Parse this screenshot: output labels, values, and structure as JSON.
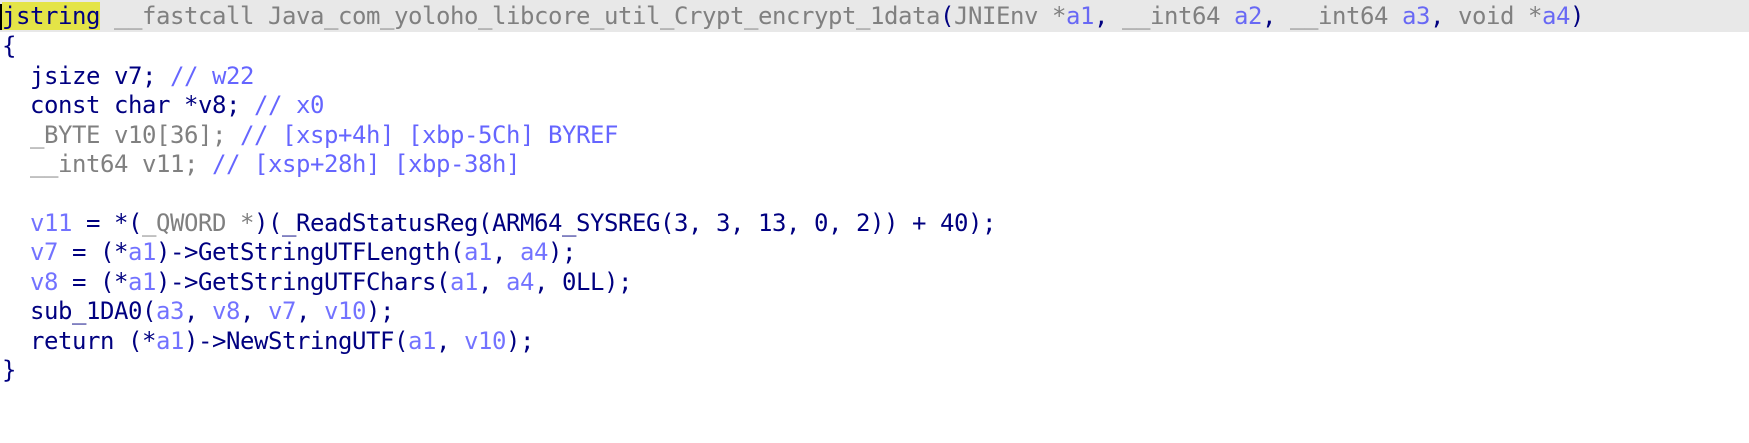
{
  "editor": {
    "lines": [
      {
        "id": "signature",
        "tokens": [
          {
            "text": "jstring",
            "kind": "hl"
          },
          {
            "text": " __fastcall Java_com_yoloho_libcore_util_Crypt_encrypt_1data",
            "kind": "gray"
          },
          {
            "text": "(",
            "kind": "punc"
          },
          {
            "text": "JNIEnv *",
            "kind": "gray"
          },
          {
            "text": "a1",
            "kind": "var"
          },
          {
            "text": ", ",
            "kind": "punc"
          },
          {
            "text": "__int64 ",
            "kind": "gray"
          },
          {
            "text": "a2",
            "kind": "var"
          },
          {
            "text": ", ",
            "kind": "punc"
          },
          {
            "text": "__int64 ",
            "kind": "gray"
          },
          {
            "text": "a3",
            "kind": "var"
          },
          {
            "text": ", ",
            "kind": "punc"
          },
          {
            "text": "void *",
            "kind": "gray"
          },
          {
            "text": "a4",
            "kind": "var"
          },
          {
            "text": ")",
            "kind": "punc"
          }
        ]
      },
      {
        "id": "open-brace",
        "tokens": [
          {
            "text": "{",
            "kind": "punc"
          }
        ]
      },
      {
        "id": "decl-v7",
        "tokens": [
          {
            "text": "  jsize ",
            "kind": "kw"
          },
          {
            "text": "v7",
            "kind": "plain"
          },
          {
            "text": "; ",
            "kind": "punc"
          },
          {
            "text": "// w22",
            "kind": "cm"
          }
        ]
      },
      {
        "id": "decl-v8",
        "tokens": [
          {
            "text": "  const char *",
            "kind": "kw"
          },
          {
            "text": "v8",
            "kind": "plain"
          },
          {
            "text": "; ",
            "kind": "punc"
          },
          {
            "text": "// x0",
            "kind": "cm"
          }
        ]
      },
      {
        "id": "decl-v10",
        "tokens": [
          {
            "text": "  _BYTE v10[36]; ",
            "kind": "gray"
          },
          {
            "text": "// [xsp+4h] [xbp-5Ch] BYREF",
            "kind": "cm"
          }
        ]
      },
      {
        "id": "decl-v11",
        "tokens": [
          {
            "text": "  __int64 v11; ",
            "kind": "gray"
          },
          {
            "text": "// [xsp+28h] [xbp-38h]",
            "kind": "cm"
          }
        ]
      },
      {
        "id": "blank",
        "tokens": [
          {
            "text": "",
            "kind": "plain"
          }
        ]
      },
      {
        "id": "stmt-v11",
        "tokens": [
          {
            "text": "  ",
            "kind": "plain"
          },
          {
            "text": "v11",
            "kind": "var"
          },
          {
            "text": " = *(",
            "kind": "punc"
          },
          {
            "text": "_QWORD *",
            "kind": "gray"
          },
          {
            "text": ")(",
            "kind": "punc"
          },
          {
            "text": "_ReadStatusReg",
            "kind": "fn"
          },
          {
            "text": "(ARM64_SYSREG(3, 3, 13, 0, 2)) + 40);",
            "kind": "punc"
          }
        ]
      },
      {
        "id": "stmt-v7",
        "tokens": [
          {
            "text": "  ",
            "kind": "plain"
          },
          {
            "text": "v7",
            "kind": "var"
          },
          {
            "text": " = (*",
            "kind": "punc"
          },
          {
            "text": "a1",
            "kind": "var"
          },
          {
            "text": ")->GetStringUTFLength(",
            "kind": "punc"
          },
          {
            "text": "a1",
            "kind": "var"
          },
          {
            "text": ", ",
            "kind": "punc"
          },
          {
            "text": "a4",
            "kind": "var"
          },
          {
            "text": ");",
            "kind": "punc"
          }
        ]
      },
      {
        "id": "stmt-v8",
        "tokens": [
          {
            "text": "  ",
            "kind": "plain"
          },
          {
            "text": "v8",
            "kind": "var"
          },
          {
            "text": " = (*",
            "kind": "punc"
          },
          {
            "text": "a1",
            "kind": "var"
          },
          {
            "text": ")->GetStringUTFChars(",
            "kind": "punc"
          },
          {
            "text": "a1",
            "kind": "var"
          },
          {
            "text": ", ",
            "kind": "punc"
          },
          {
            "text": "a4",
            "kind": "var"
          },
          {
            "text": ", 0LL);",
            "kind": "punc"
          }
        ]
      },
      {
        "id": "stmt-sub",
        "tokens": [
          {
            "text": "  sub_1DA0(",
            "kind": "fn"
          },
          {
            "text": "a3",
            "kind": "var"
          },
          {
            "text": ", ",
            "kind": "punc"
          },
          {
            "text": "v8",
            "kind": "var"
          },
          {
            "text": ", ",
            "kind": "punc"
          },
          {
            "text": "v7",
            "kind": "var"
          },
          {
            "text": ", ",
            "kind": "punc"
          },
          {
            "text": "v10",
            "kind": "var"
          },
          {
            "text": ");",
            "kind": "punc"
          }
        ]
      },
      {
        "id": "stmt-return",
        "tokens": [
          {
            "text": "  return (*",
            "kind": "kw"
          },
          {
            "text": "a1",
            "kind": "var"
          },
          {
            "text": ")->NewStringUTF(",
            "kind": "punc"
          },
          {
            "text": "a1",
            "kind": "var"
          },
          {
            "text": ", ",
            "kind": "punc"
          },
          {
            "text": "v10",
            "kind": "var"
          },
          {
            "text": ");",
            "kind": "punc"
          }
        ]
      },
      {
        "id": "close-brace",
        "tokens": [
          {
            "text": "}",
            "kind": "punc"
          }
        ]
      }
    ],
    "colors": {
      "background": "#ffffff",
      "current_line": "#e8e8e8",
      "highlight": "#e4e447",
      "identifier": "#000080",
      "type_gray": "#808080",
      "variable": "#0000ff",
      "comment": "#0000ff"
    }
  }
}
